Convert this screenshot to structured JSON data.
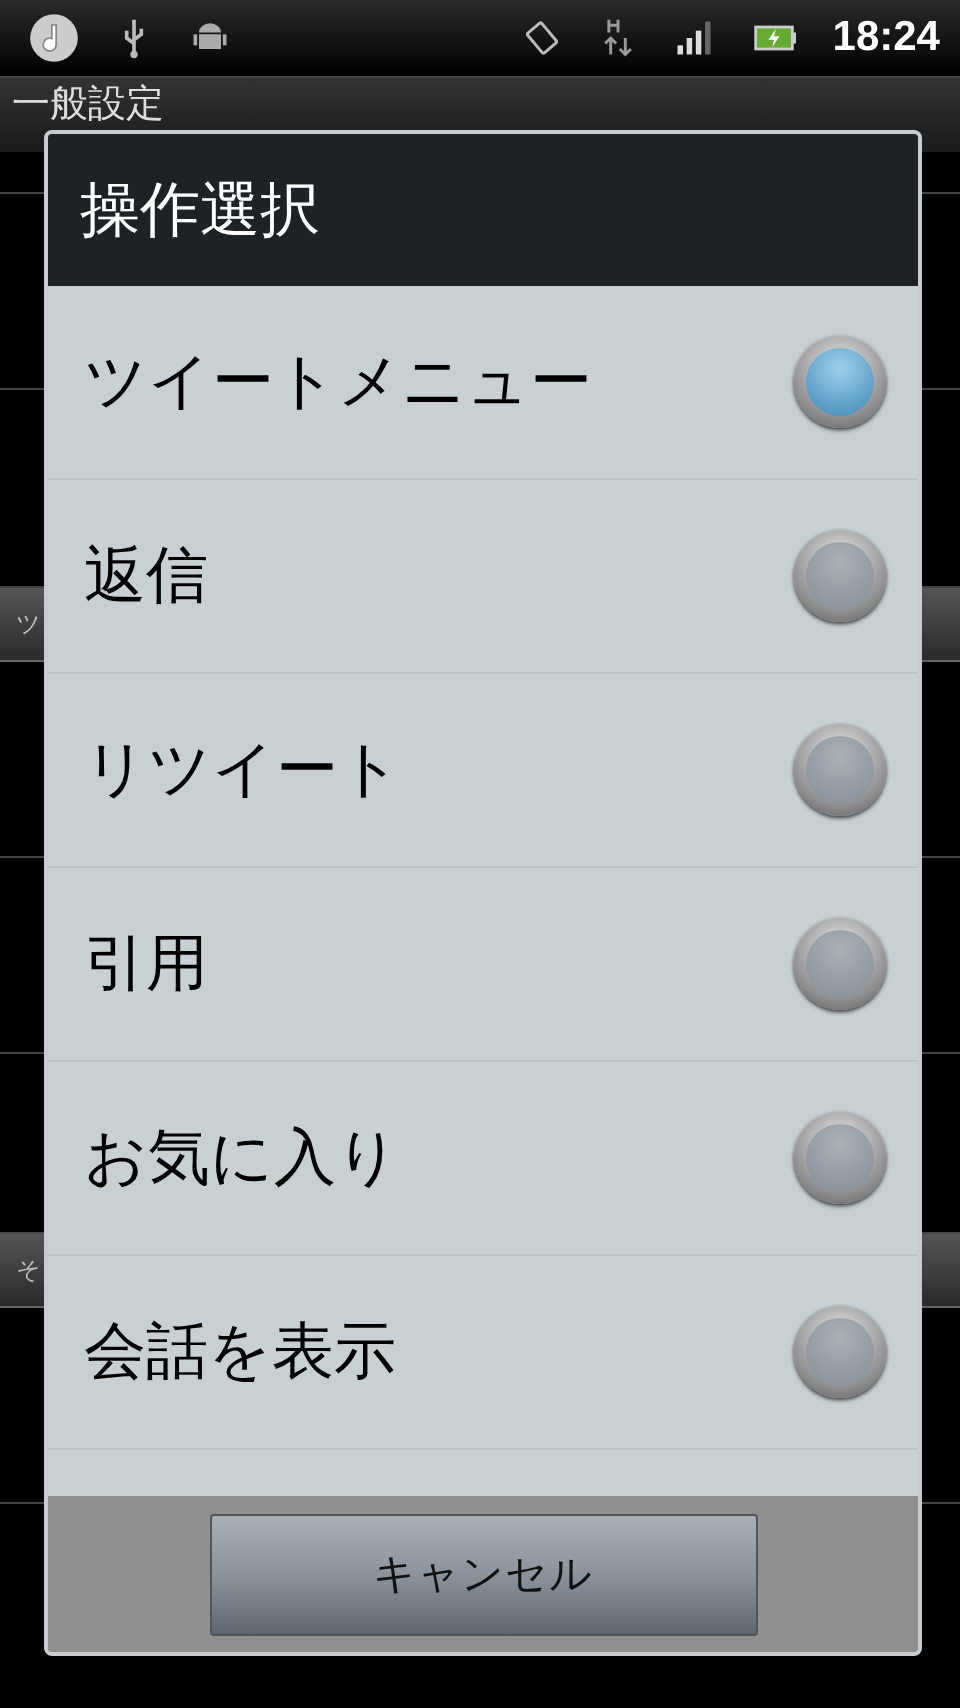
{
  "status_bar": {
    "time": "18:24"
  },
  "screen": {
    "title": "一般設定",
    "sections": [
      {
        "header": "ツ"
      },
      {
        "header": "そ"
      }
    ]
  },
  "dialog": {
    "title": "操作選択",
    "options": [
      {
        "label": "ツイートメニュー",
        "selected": true
      },
      {
        "label": "返信",
        "selected": false
      },
      {
        "label": "リツイート",
        "selected": false
      },
      {
        "label": "引用",
        "selected": false
      },
      {
        "label": "お気に入り",
        "selected": false
      },
      {
        "label": "会話を表示",
        "selected": false
      }
    ],
    "cancel": "キャンセル"
  }
}
